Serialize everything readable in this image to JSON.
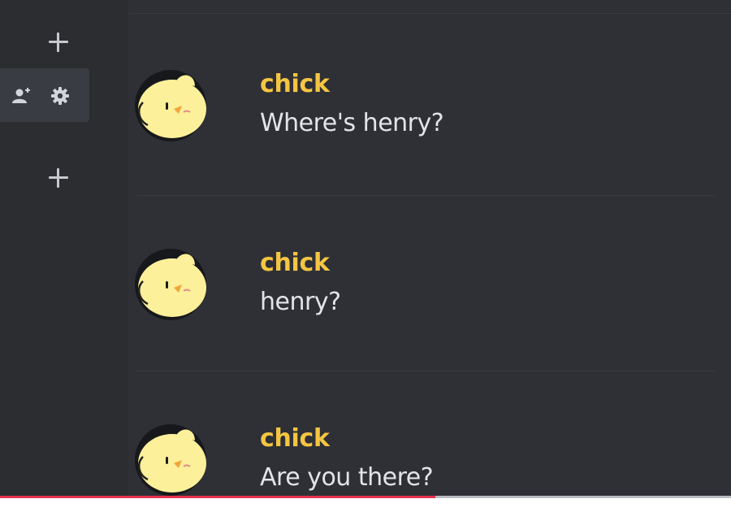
{
  "sidebar": {
    "add_channel_icon": "plus-icon",
    "invite_icon": "add-member-icon",
    "settings_icon": "gear-icon",
    "add_channel_icon_2": "plus-icon"
  },
  "messages": [
    {
      "username": "chick",
      "text": "Where's henry?",
      "avatar": "chick-avatar"
    },
    {
      "username": "chick",
      "text": "henry?",
      "avatar": "chick-avatar"
    },
    {
      "username": "chick",
      "text": "Are you there?",
      "avatar": "chick-avatar"
    }
  ],
  "video": {
    "progress": 0.595
  },
  "colors": {
    "background": "#2e3036",
    "sidebar": "#2b2d31",
    "username": "#f5c542",
    "message_text": "#e3e4e8",
    "avatar_face": "#fdf09a",
    "progress": "#e8304a"
  }
}
